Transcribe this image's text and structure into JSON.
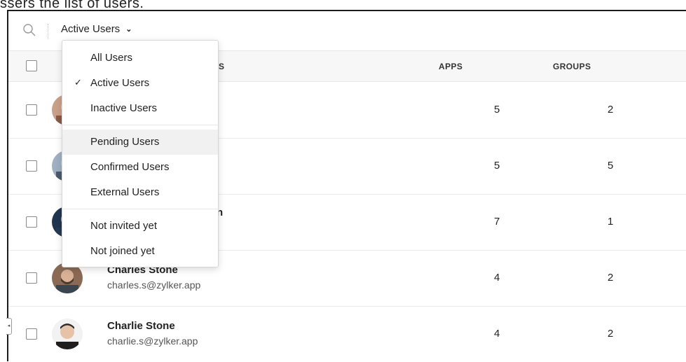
{
  "caption": "ssers the list of users.",
  "filter": {
    "selected": "Active Users"
  },
  "table": {
    "columns": [
      "APPS",
      "GROUPS"
    ],
    "col_partial": "S",
    "rows": [
      {
        "name": "",
        "email": "",
        "apps": "5",
        "groups": "2"
      },
      {
        "name": "",
        "email": "",
        "apps": "5",
        "groups": "5"
      },
      {
        "name": "",
        "email": "",
        "apps": "7",
        "groups": "1"
      },
      {
        "name": "Charles Stone",
        "email": "charles.s@zylker.app",
        "apps": "4",
        "groups": "2"
      },
      {
        "name": "Charlie Stone",
        "email": "charlie.s@zylker.app",
        "apps": "4",
        "groups": "2"
      }
    ],
    "row3_partial": "n"
  },
  "dropdown": {
    "options": [
      {
        "label": "All Users"
      },
      {
        "label": "Active Users",
        "checked": true
      },
      {
        "label": "Inactive Users"
      },
      {
        "label": "Pending Users",
        "highlighted": true
      },
      {
        "label": "Confirmed Users"
      },
      {
        "label": "External Users"
      },
      {
        "label": "Not invited yet"
      },
      {
        "label": "Not joined yet"
      }
    ],
    "check_glyph": "✓"
  },
  "icons": {
    "search": "search-icon",
    "chevron": "chevron-down-icon",
    "collapse": "chevron-left-icon"
  },
  "colors": {
    "border": "#1c1c1c",
    "header_bg": "#f7f7f7",
    "highlight_bg": "#f1f1f1"
  }
}
